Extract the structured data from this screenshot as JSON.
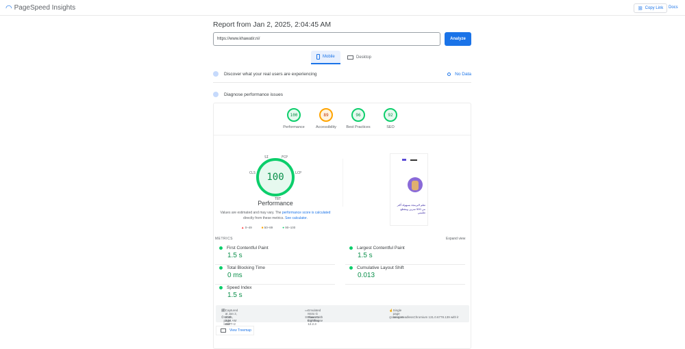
{
  "header": {
    "app": "PageSpeed Insights",
    "copy_link": "Copy Link",
    "docs": "Docs"
  },
  "report": {
    "title": "Report from Jan 2, 2025, 2:04:45 AM",
    "url": "https://www.khawatir.ni/",
    "analyze": "Analyze"
  },
  "tabs": [
    {
      "label": "Mobile"
    },
    {
      "label": "Desktop"
    }
  ],
  "field": {
    "label": "Discover what your real users are experiencing",
    "status": "No Data"
  },
  "lab": {
    "label": "Diagnose performance issues"
  },
  "scores": [
    {
      "value": "100",
      "label": "Performance"
    },
    {
      "value": "89",
      "label": "Accessibility"
    },
    {
      "value": "96",
      "label": "Best Practices"
    },
    {
      "value": "92",
      "label": "SEO"
    }
  ],
  "gauge": {
    "value": "100",
    "title": "Performance",
    "labels": {
      "si": "SI",
      "fcp": "FCP",
      "lcp": "LCP",
      "tbt": "TBT",
      "cls": "CLS"
    }
  },
  "note": {
    "prefix": "Values are estimated and may vary. The ",
    "link1": "performance score is calculated",
    "mid": " directly from these metrics. ",
    "link2": "See calculator."
  },
  "legend": [
    "0–49",
    "50–89",
    "90–100"
  ],
  "screenshot_text": "تعلم البرمجة بسهولة أكثر من 500 تمرين ومقطع تعليمي",
  "metrics": {
    "label": "METRICS",
    "expand": "Expand view",
    "items": [
      {
        "name": "First Contentful Paint",
        "value": "1.5 s"
      },
      {
        "name": "Largest Contentful Paint",
        "value": "1.5 s"
      },
      {
        "name": "Total Blocking Time",
        "value": "0 ms"
      },
      {
        "name": "Cumulative Layout Shift",
        "value": "0.013"
      },
      {
        "name": "Speed Index",
        "value": "1.5 s"
      }
    ]
  },
  "info": {
    "captured": "Captured at Jan 2, 2025, 2:04 AM GMT+2",
    "load": "Initial page load",
    "device": "Emulated Moto G Power with Lighthouse 12.2.3",
    "throttle": "Slow 4G throttling",
    "session": "Single page session",
    "browser": "Using HeadlessChromium 131.0.6778.139 with lr"
  },
  "treemap": "View Treemap"
}
